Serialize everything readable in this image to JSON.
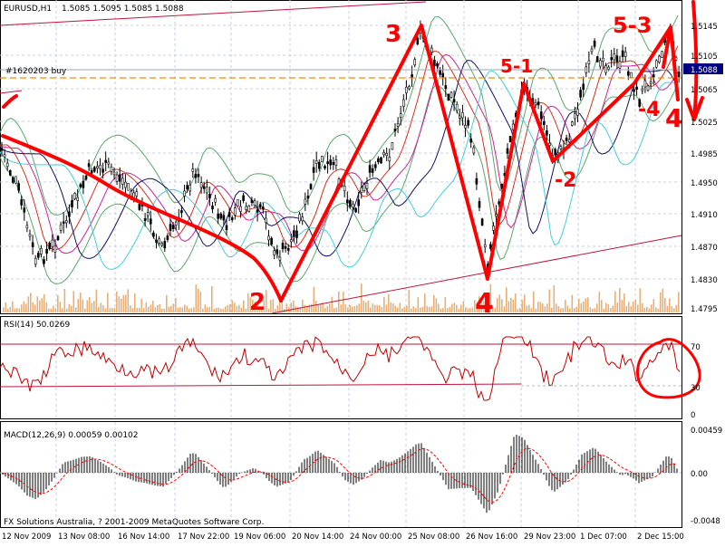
{
  "main_panel": {
    "symbol_label": "EURUSD,H1",
    "ohlc": "1.5085 1.5095 1.5085 1.5088",
    "order_label": "#1620203 buy",
    "price_ticks": [
      "1.5145",
      "1.5105",
      "1.5065",
      "1.5025",
      "1.4985",
      "1.4950",
      "1.4910",
      "1.4870",
      "1.4830",
      "1.4795"
    ],
    "current_price": "1.5088",
    "annotations": [
      "3",
      "5-3",
      "5-1",
      "2",
      "4",
      "-2",
      "-4",
      "4"
    ]
  },
  "rsi_panel": {
    "label": "RSI(14) 50.0269",
    "levels": [
      "70",
      "30",
      "0"
    ]
  },
  "macd_panel": {
    "label": "MACD(12,26,9) 0.00059 0.00102",
    "levels": [
      "0.00459",
      "0.00",
      "-0.0048"
    ],
    "copyright": "FX Solutions Australia, ? 2001-2009 MetaQuotes Software Corp."
  },
  "time_axis": [
    "12 Nov 2009",
    "13 Nov 08:00",
    "16 Nov 14:00",
    "17 Nov 22:00",
    "19 Nov 06:00",
    "20 Nov 14:00",
    "24 Nov 00:00",
    "25 Nov 08:00",
    "26 Nov 16:00",
    "29 Nov 23:00",
    "1 Dec 07:00",
    "2 Dec 15:00"
  ],
  "colors": {
    "annotation": "#ff0000",
    "grid": "#c8d0dc",
    "candle": "#000000",
    "bollinger": "#5aa86a",
    "rsi": "#c00000",
    "macd_signal": "#ff0000",
    "volume": "#e8b078",
    "order_line": "#ff8800",
    "price_tag_bg": "#000080"
  }
}
